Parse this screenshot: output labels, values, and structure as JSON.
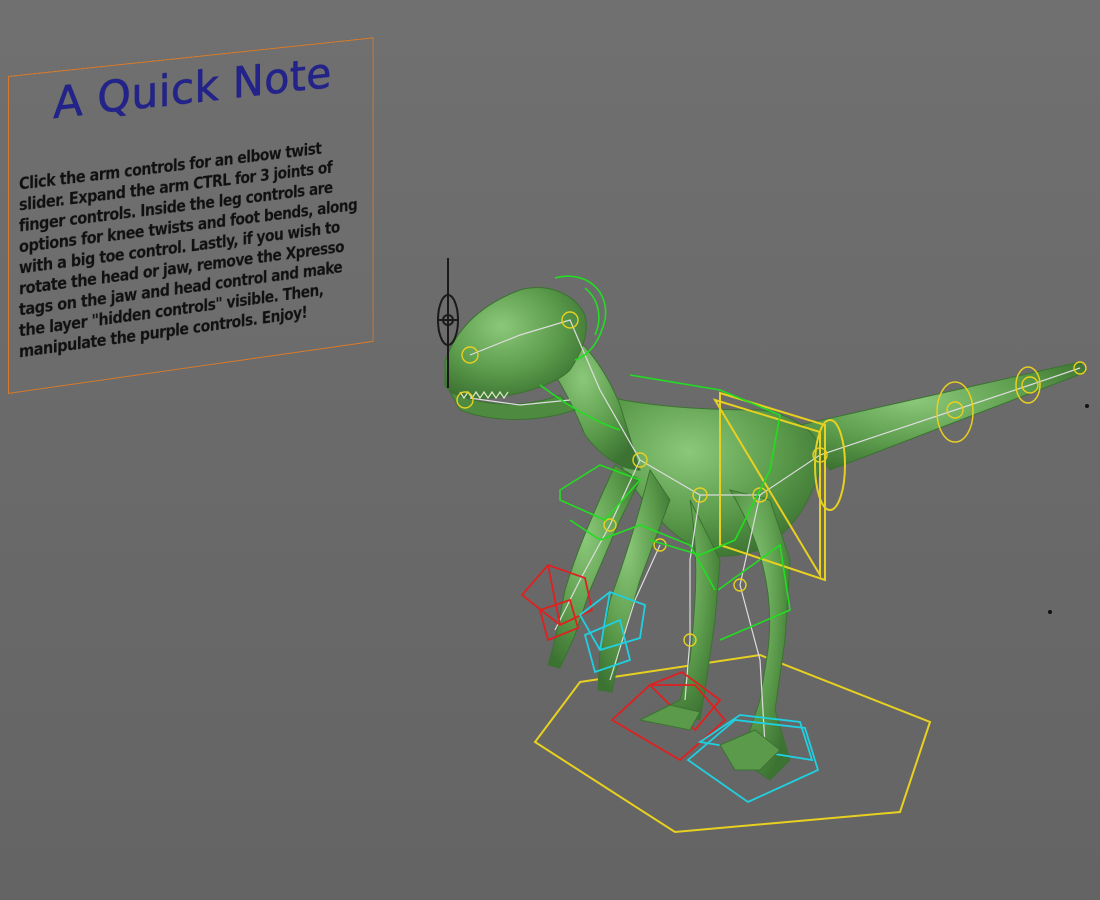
{
  "viewport": {
    "background_top": "#707070",
    "background_bottom": "#646464"
  },
  "note": {
    "title": "A Quick Note",
    "body": "Click the arm controls for an elbow twist slider. Expand the arm CTRL for 3 joints of finger controls. Inside the leg controls are options for knee twists and foot bends, along with a big toe control.  Lastly, if you wish to rotate the head or jaw, remove the Xpresso tags on the jaw and head control and make the layer \"hidden controls\" visible. Then, manipulate the purple controls.  Enjoy!",
    "border_color": "#d87a28",
    "title_color": "#23238c"
  },
  "rig": {
    "model_color": "#5a9a4a",
    "bone_color": "#dcdcdc",
    "control_colors": {
      "spine": "#22dd22",
      "root": "#e8d020",
      "hand_left": "#e02020",
      "hand_right": "#20d0e0",
      "foot_left": "#e02020",
      "foot_right": "#20d0e0",
      "head_pivot": "#1a1a1a"
    }
  }
}
